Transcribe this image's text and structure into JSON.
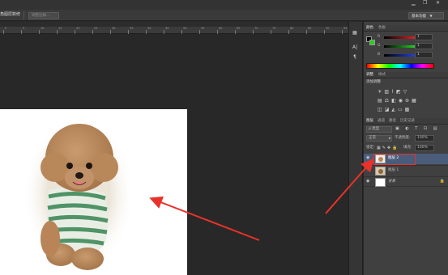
{
  "options_bar": {
    "title_fragment": "角图层数修",
    "adjust_edge_label": "调整边缘...",
    "workspace_label": "基本功能"
  },
  "ruler": {
    "ticks": [
      "0",
      "5",
      "10",
      "15",
      "20",
      "25",
      "30",
      "35",
      "40",
      "45",
      "50",
      "55",
      "60",
      "65",
      "70",
      "75",
      "80",
      "85",
      "90",
      "95"
    ]
  },
  "color_panel": {
    "tabs": [
      "颜色",
      "色板"
    ],
    "channels": [
      {
        "label": "R",
        "value": "1"
      },
      {
        "label": "G",
        "value": "1"
      },
      {
        "label": "B",
        "value": "1"
      }
    ],
    "fg_color": "#000000",
    "bg_color": "#2ecc22"
  },
  "adjust_panel": {
    "tabs": [
      "调整",
      "样式"
    ],
    "title": "添加调整"
  },
  "layers_panel": {
    "tabs": [
      "图层",
      "通道",
      "路径",
      "历史记录"
    ],
    "filter_label": "ρ 类型",
    "blend_mode": "正常",
    "opacity_label": "不透明度:",
    "opacity_value": "100%",
    "lock_label": "锁定:",
    "fill_label": "填充:",
    "fill_value": "100%",
    "layers": [
      {
        "name": "图层 2",
        "selected": true
      },
      {
        "name": "图层 1",
        "selected": false
      },
      {
        "name": "背景",
        "selected": false
      }
    ]
  },
  "annotation": {
    "arrow_color": "#e8322b",
    "highlight_color": "#e8322b"
  }
}
